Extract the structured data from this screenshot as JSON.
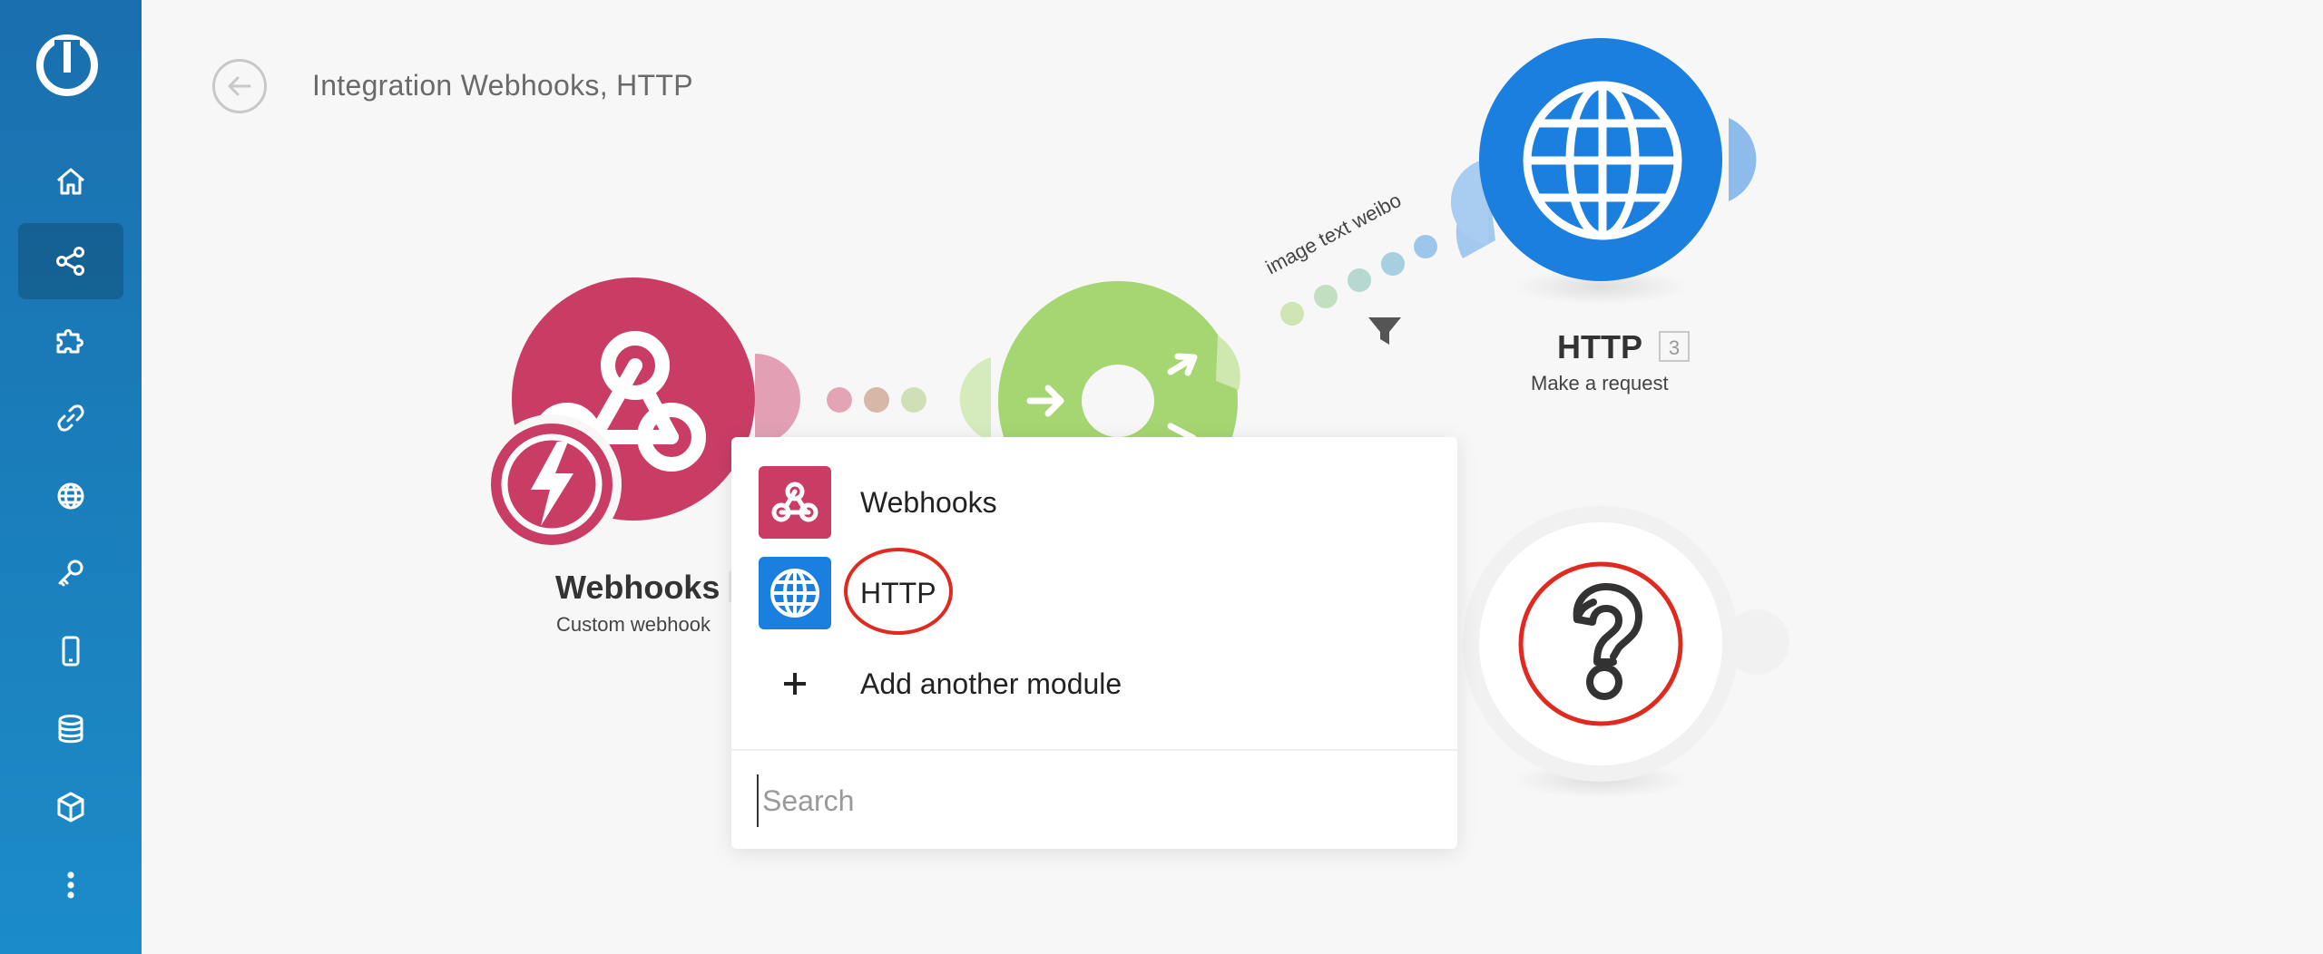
{
  "header": {
    "title": "Integration Webhooks, HTTP"
  },
  "sidebar": {
    "items": [
      {
        "name": "home-icon"
      },
      {
        "name": "share-icon",
        "active": true
      },
      {
        "name": "puzzle-icon"
      },
      {
        "name": "link-icon"
      },
      {
        "name": "globe-icon"
      },
      {
        "name": "key-icon"
      },
      {
        "name": "mobile-icon"
      },
      {
        "name": "database-icon"
      },
      {
        "name": "cube-icon"
      },
      {
        "name": "more-icon"
      }
    ]
  },
  "canvas": {
    "webhooks_module": {
      "label": "Webhooks",
      "subtitle": "Custom webhook",
      "color": "#c93d65"
    },
    "router_module": {
      "color": "#a6d672"
    },
    "http_module": {
      "label": "HTTP",
      "number": "3",
      "subtitle": "Make a request",
      "color": "#1b7fe0"
    },
    "route_label": "image text weibo",
    "unknown_module": {
      "icon": "question-icon"
    }
  },
  "module_menu": {
    "items": [
      {
        "label": "Webhooks",
        "icon": "webhooks-icon"
      },
      {
        "label": "HTTP",
        "icon": "globe-icon"
      },
      {
        "label": "Add another module",
        "icon": "plus-icon"
      }
    ],
    "search_placeholder": "Search"
  },
  "colors": {
    "sidebar": "#1a7ab8",
    "webhooks": "#c93d65",
    "http": "#1b7fe0",
    "router": "#a6d672",
    "highlight": "#e0291f"
  }
}
